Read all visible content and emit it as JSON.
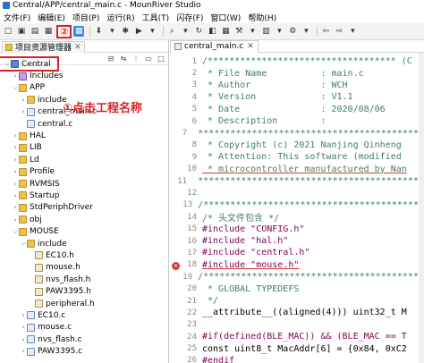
{
  "window": {
    "title": "Central/APP/central_main.c - MounRiver Studio"
  },
  "menu": [
    "文件(F)",
    "编辑(E)",
    "项目(P)",
    "运行(R)",
    "工具(T)",
    "闪存(F)",
    "窗口(W)",
    "帮助(H)"
  ],
  "toolbar": {
    "annotation_2": "②"
  },
  "left_panel": {
    "tab_label": "项目资源管理器",
    "annotation_1": "①点击工程名称",
    "tree": [
      {
        "label": "Central",
        "depth": 0,
        "expanded": true,
        "icon": "project-icon",
        "selected": true
      },
      {
        "label": "Includes",
        "depth": 1,
        "expanded": false,
        "icon": "includes-icon"
      },
      {
        "label": "APP",
        "depth": 1,
        "expanded": true,
        "icon": "folder-icon"
      },
      {
        "label": "include",
        "depth": 2,
        "expanded": false,
        "icon": "folder-icon"
      },
      {
        "label": "central_main.c",
        "depth": 2,
        "expanded": false,
        "icon": "c-file-icon"
      },
      {
        "label": "central.c",
        "depth": 2,
        "expanded": null,
        "icon": "c-file-icon"
      },
      {
        "label": "HAL",
        "depth": 1,
        "expanded": false,
        "icon": "folder-icon"
      },
      {
        "label": "LIB",
        "depth": 1,
        "expanded": false,
        "icon": "folder-icon"
      },
      {
        "label": "Ld",
        "depth": 1,
        "expanded": false,
        "icon": "folder-icon"
      },
      {
        "label": "Profile",
        "depth": 1,
        "expanded": false,
        "icon": "folder-icon"
      },
      {
        "label": "RVMSIS",
        "depth": 1,
        "expanded": false,
        "icon": "folder-icon"
      },
      {
        "label": "Startup",
        "depth": 1,
        "expanded": false,
        "icon": "folder-icon"
      },
      {
        "label": "StdPeriphDriver",
        "depth": 1,
        "expanded": false,
        "icon": "folder-icon"
      },
      {
        "label": "obj",
        "depth": 1,
        "expanded": false,
        "icon": "folder-icon"
      },
      {
        "label": "MOUSE",
        "depth": 1,
        "expanded": true,
        "icon": "folder-icon"
      },
      {
        "label": "include",
        "depth": 2,
        "expanded": true,
        "icon": "folder-icon"
      },
      {
        "label": "EC10.h",
        "depth": 3,
        "expanded": null,
        "icon": "h-file-icon"
      },
      {
        "label": "mouse.h",
        "depth": 3,
        "expanded": null,
        "icon": "h-file-icon"
      },
      {
        "label": "nvs_flash.h",
        "depth": 3,
        "expanded": null,
        "icon": "h-file-icon"
      },
      {
        "label": "PAW3395.h",
        "depth": 3,
        "expanded": null,
        "icon": "h-file-icon"
      },
      {
        "label": "peripheral.h",
        "depth": 3,
        "expanded": null,
        "icon": "h-file-icon"
      },
      {
        "label": "EC10.c",
        "depth": 2,
        "expanded": false,
        "icon": "c-file-icon"
      },
      {
        "label": "mouse.c",
        "depth": 2,
        "expanded": false,
        "icon": "c-file-icon"
      },
      {
        "label": "nvs_flash.c",
        "depth": 2,
        "expanded": false,
        "icon": "c-file-icon"
      },
      {
        "label": "PAW3395.c",
        "depth": 2,
        "expanded": false,
        "icon": "c-file-icon"
      }
    ]
  },
  "editor": {
    "tab_label": "central_main.c",
    "lines": [
      {
        "n": "1",
        "text": "/*********************************** (C",
        "kind": "cm"
      },
      {
        "n": "2",
        "text": " * File Name          : main.c",
        "kind": "cm"
      },
      {
        "n": "3",
        "text": " * Author             : WCH",
        "kind": "cm"
      },
      {
        "n": "4",
        "text": " * Version            : V1.1",
        "kind": "cm"
      },
      {
        "n": "5",
        "text": " * Date               : 2020/08/06",
        "kind": "cm"
      },
      {
        "n": "6",
        "text": " * Description        :",
        "kind": "cm"
      },
      {
        "n": "7",
        "text": " ******************************************",
        "kind": "cm"
      },
      {
        "n": "8",
        "text": " * Copyright (c) 2021 Nanjing Qinheng",
        "kind": "cm"
      },
      {
        "n": "9",
        "text": " * Attention: This software (modified",
        "kind": "cm"
      },
      {
        "n": "10",
        "text": " * microcontroller manufactured by Nan",
        "kind": "cm-ul"
      },
      {
        "n": "11",
        "text": " ******************************************",
        "kind": "cm"
      },
      {
        "n": "12",
        "text": "",
        "kind": "norm"
      },
      {
        "n": "13",
        "text": "/*****************************************",
        "kind": "cm"
      },
      {
        "n": "14",
        "text": "/* 头文件包含 */",
        "kind": "cm"
      },
      {
        "n": "15",
        "text": "#include \"CONFIG.h\"",
        "kind": "dir"
      },
      {
        "n": "16",
        "text": "#include \"hal.h\"",
        "kind": "dir"
      },
      {
        "n": "17",
        "text": "#include \"central.h\"",
        "kind": "dir"
      },
      {
        "n": "18",
        "text": "#include \"mouse.h\"",
        "kind": "dir-err"
      },
      {
        "n": "19",
        "text": "/*****************************************",
        "kind": "cm"
      },
      {
        "n": "20",
        "text": " * GLOBAL TYPEDEFS",
        "kind": "cm"
      },
      {
        "n": "21",
        "text": " */",
        "kind": "cm"
      },
      {
        "n": "22",
        "text": "__attribute__((aligned(4))) uint32_t M",
        "kind": "norm"
      },
      {
        "n": "23",
        "text": "",
        "kind": "norm"
      },
      {
        "n": "24",
        "text": "#if(defined(BLE_MAC)) && (BLE_MAC == T",
        "kind": "dir"
      },
      {
        "n": "25",
        "text": "const uint8_t MacAddr[6] = {0x84, 0xC2",
        "kind": "norm"
      },
      {
        "n": "26",
        "text": "#endif",
        "kind": "dir"
      },
      {
        "n": "27",
        "text": "",
        "kind": "norm"
      }
    ]
  },
  "colors": {
    "annotation": "#e02020",
    "comment": "#3f7f5f",
    "directive": "#7f0055",
    "error_marker": "#d63a2f"
  }
}
